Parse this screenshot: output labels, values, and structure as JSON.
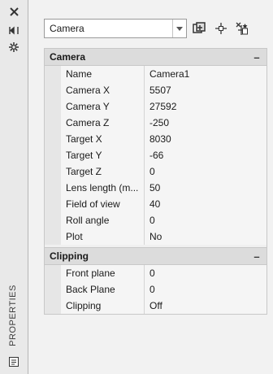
{
  "palette_title": "PROPERTIES",
  "selection": {
    "value": "Camera"
  },
  "categories": [
    {
      "title": "Camera",
      "collapse_glyph": "–",
      "rows": [
        {
          "name": "Name",
          "value": "Camera1"
        },
        {
          "name": "Camera X",
          "value": "5507"
        },
        {
          "name": "Camera Y",
          "value": "27592"
        },
        {
          "name": "Camera Z",
          "value": "-250"
        },
        {
          "name": "Target X",
          "value": "8030"
        },
        {
          "name": "Target Y",
          "value": "-66"
        },
        {
          "name": "Target Z",
          "value": "0"
        },
        {
          "name": "Lens length (m...",
          "value": "50"
        },
        {
          "name": "Field of view",
          "value": "40"
        },
        {
          "name": "Roll angle",
          "value": "0"
        },
        {
          "name": "Plot",
          "value": "No"
        }
      ]
    },
    {
      "title": "Clipping",
      "collapse_glyph": "–",
      "rows": [
        {
          "name": "Front plane",
          "value": "0"
        },
        {
          "name": "Back Plane",
          "value": "0"
        },
        {
          "name": "Clipping",
          "value": "Off"
        }
      ]
    }
  ],
  "icons": {
    "close": "close-icon",
    "autohide": "autohide-icon",
    "settings": "settings-icon",
    "toggle_pickadd": "toggle-pickadd-icon",
    "select_objects": "select-objects-icon",
    "quick_select": "quick-select-icon",
    "dropdown": "dropdown-arrow-icon",
    "palette_menu": "palette-menu-icon"
  }
}
